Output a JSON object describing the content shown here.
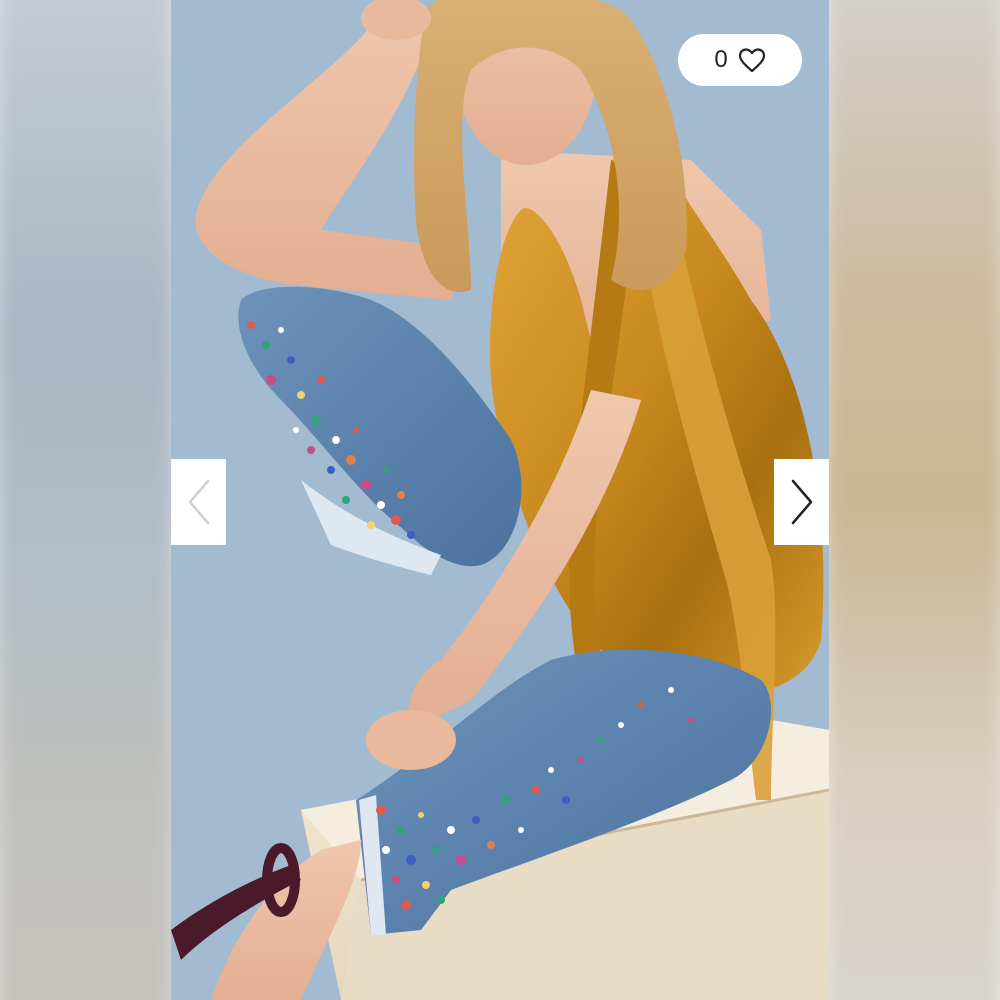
{
  "listing": {
    "likes": {
      "count": "0",
      "icon": "heart-outline-icon"
    },
    "navigation": {
      "previous_icon": "chevron-left-icon",
      "next_icon": "chevron-right-icon"
    },
    "photo": {
      "subject": "product-photo-embellished-jeans"
    }
  },
  "colors": {
    "backdrop_blue": "#a2bbd0",
    "blouse_gold": "#c88a1e",
    "denim_blue": "#5b82ad",
    "box_cream": "#efe3cf",
    "shoe_burgundy": "#4a1a2a",
    "prev_chevron": "#cfcfcf",
    "next_chevron": "#222222"
  }
}
